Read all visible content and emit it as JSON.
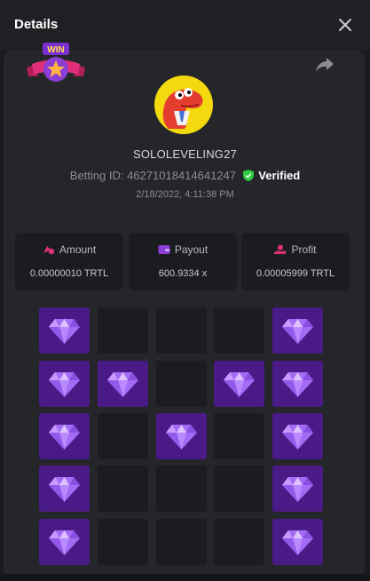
{
  "header": {
    "title": "Details"
  },
  "player": {
    "username": "SOLOLEVELING27",
    "betting_id_label": "Betting ID:",
    "betting_id": "46271018414641247",
    "verified_label": "Verified",
    "datetime": "2/18/2022, 4:11:38 PM"
  },
  "badge": {
    "text": "WIN"
  },
  "stats": [
    {
      "label": "Amount",
      "value": "0.00000010 TRTL",
      "icon": "coins-icon"
    },
    {
      "label": "Payout",
      "value": "600.9334 x",
      "icon": "wallet-icon"
    },
    {
      "label": "Profit",
      "value": "0.00005999 TRTL",
      "icon": "hand-coin-icon"
    }
  ],
  "board": {
    "rows": 5,
    "cols": 5,
    "cells": [
      [
        1,
        0,
        0,
        0,
        1
      ],
      [
        1,
        1,
        0,
        1,
        1
      ],
      [
        1,
        0,
        1,
        0,
        1
      ],
      [
        1,
        0,
        0,
        0,
        1
      ],
      [
        1,
        0,
        0,
        0,
        1
      ]
    ]
  },
  "colors": {
    "gem_tile": "#4a1a87",
    "empty_tile": "#1b1c1f",
    "verified": "#2ecc40",
    "accent": "#e0307a"
  }
}
